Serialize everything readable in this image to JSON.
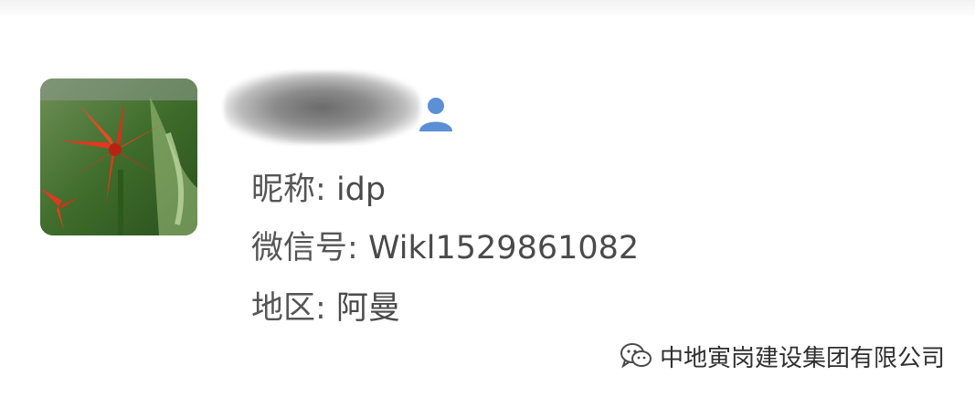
{
  "profile": {
    "nickname_label": "昵称:",
    "nickname_value": "idp",
    "wechat_label": "微信号:",
    "wechat_value": "Wikl1529861082",
    "region_label": "地区:",
    "region_value": "阿曼"
  },
  "watermark": {
    "text": "中地寅岗建设集团有限公司",
    "icon": "wechat-logo-icon"
  },
  "colors": {
    "text": "#555555",
    "accent_icon": "#5b8fd6"
  }
}
